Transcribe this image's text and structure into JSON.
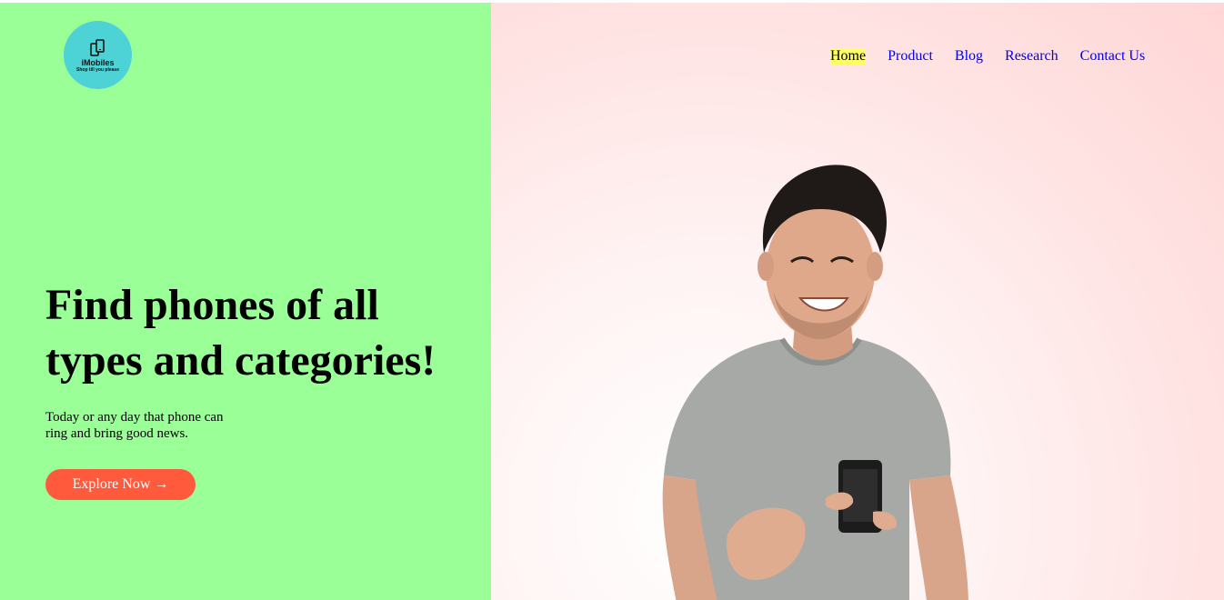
{
  "brand": {
    "name": "iMobiles",
    "tagline": "Shop till you please",
    "logo_icon": "phones-icon"
  },
  "nav": {
    "items": [
      {
        "label": "Home",
        "active": true
      },
      {
        "label": "Product",
        "active": false
      },
      {
        "label": "Blog",
        "active": false
      },
      {
        "label": "Research",
        "active": false
      },
      {
        "label": "Contact Us",
        "active": false
      }
    ]
  },
  "hero": {
    "headline": "Find phones of all types and categories!",
    "subtext": "Today or any day that phone can ring and bring good news.",
    "cta_label": "Explore Now",
    "cta_icon": "→",
    "image": "smiling-man-with-phone"
  },
  "colors": {
    "left_bg": "#9bff98",
    "logo_bg": "#4dd3d6",
    "cta_bg": "#ff5a3c",
    "nav_link": "#0000ee",
    "nav_active_bg": "#ffff66"
  }
}
